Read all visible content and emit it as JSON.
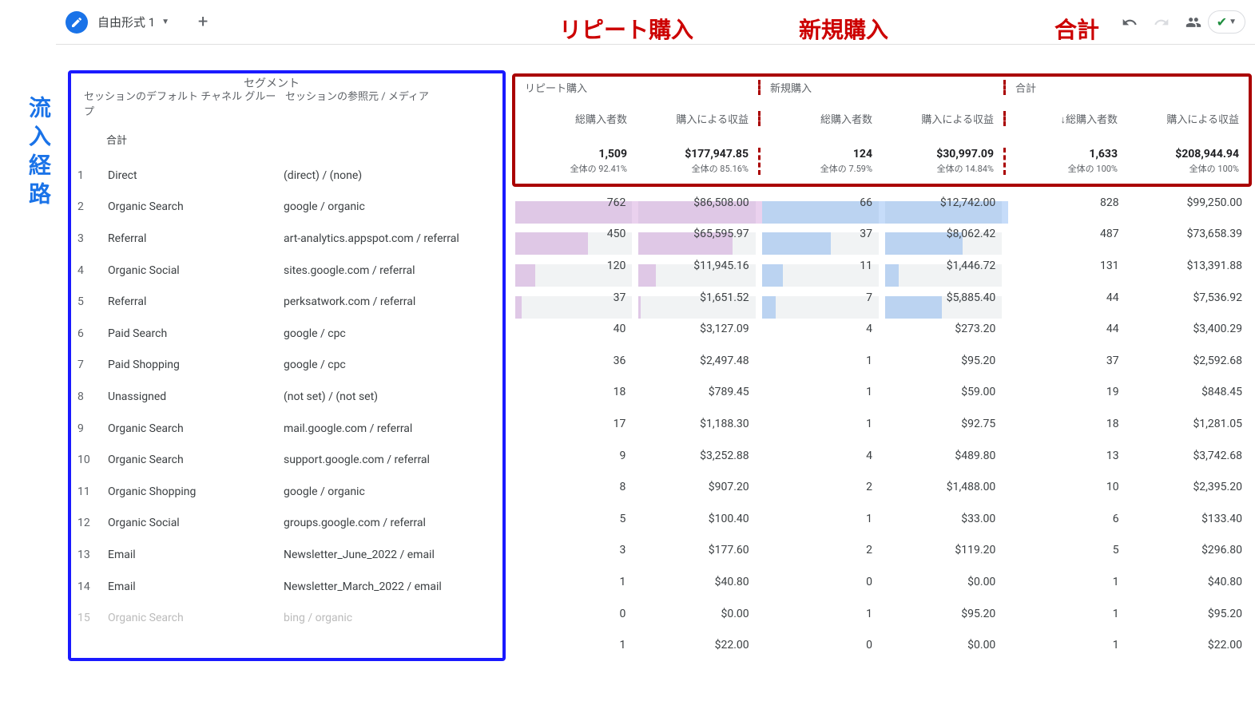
{
  "annotations": {
    "repeat": "リピート購入",
    "new": "新規購入",
    "total": "合計",
    "inflow": "流入経路"
  },
  "toolbar": {
    "tab_name": "自由形式 1",
    "segment_label": "セグメント"
  },
  "columns": {
    "channel_group": "セッションのデフォルト チャネル グループ",
    "source_medium": "セッションの参照元 / メディア",
    "seg_repeat": "リピート購入",
    "seg_new": "新規購入",
    "seg_total": "合計",
    "purchasers": "総購入者数",
    "revenue": "購入による収益",
    "sort_purchasers": "↓総購入者数",
    "total_label": "合計"
  },
  "totals": {
    "repeat_purchasers": "1,509",
    "repeat_purchasers_pct": "全体の 92.41%",
    "repeat_revenue": "$177,947.85",
    "repeat_revenue_pct": "全体の 85.16%",
    "new_purchasers": "124",
    "new_purchasers_pct": "全体の 7.59%",
    "new_revenue": "$30,997.09",
    "new_revenue_pct": "全体の 14.84%",
    "total_purchasers": "1,633",
    "total_purchasers_pct": "全体の 100%",
    "total_revenue": "$208,944.94",
    "total_revenue_pct": "全体の 100%"
  },
  "rows": [
    {
      "n": "1",
      "channel": "Direct",
      "source": "(direct) / (none)",
      "rp": "762",
      "rr": "$86,508.00",
      "np": "66",
      "nr": "$12,742.00",
      "tp": "828",
      "tr": "$99,250.00",
      "rp_bar": 100,
      "rr_bar": 100,
      "np_bar": 100,
      "nr_bar": 100
    },
    {
      "n": "2",
      "channel": "Organic Search",
      "source": "google / organic",
      "rp": "450",
      "rr": "$65,595.97",
      "np": "37",
      "nr": "$8,062.42",
      "tp": "487",
      "tr": "$73,658.39",
      "rp_bar": 59,
      "rr_bar": 76,
      "np_bar": 56,
      "nr_bar": 63
    },
    {
      "n": "3",
      "channel": "Referral",
      "source": "art-analytics.appspot.com / referral",
      "rp": "120",
      "rr": "$11,945.16",
      "np": "11",
      "nr": "$1,446.72",
      "tp": "131",
      "tr": "$13,391.88",
      "rp_bar": 16,
      "rr_bar": 14,
      "np_bar": 17,
      "nr_bar": 11
    },
    {
      "n": "4",
      "channel": "Organic Social",
      "source": "sites.google.com / referral",
      "rp": "37",
      "rr": "$1,651.52",
      "np": "7",
      "nr": "$5,885.40",
      "tp": "44",
      "tr": "$7,536.92",
      "rp_bar": 5,
      "rr_bar": 2,
      "np_bar": 11,
      "nr_bar": 46
    },
    {
      "n": "5",
      "channel": "Referral",
      "source": "perksatwork.com / referral",
      "rp": "40",
      "rr": "$3,127.09",
      "np": "4",
      "nr": "$273.20",
      "tp": "44",
      "tr": "$3,400.29",
      "rp_bar": 5,
      "rr_bar": 4,
      "np_bar": 6,
      "nr_bar": 2
    },
    {
      "n": "6",
      "channel": "Paid Search",
      "source": "google / cpc",
      "rp": "36",
      "rr": "$2,497.48",
      "np": "1",
      "nr": "$95.20",
      "tp": "37",
      "tr": "$2,592.68",
      "rp_bar": 5,
      "rr_bar": 3,
      "np_bar": 2,
      "nr_bar": 1
    },
    {
      "n": "7",
      "channel": "Paid Shopping",
      "source": "google / cpc",
      "rp": "18",
      "rr": "$789.45",
      "np": "1",
      "nr": "$59.00",
      "tp": "19",
      "tr": "$848.45",
      "rp_bar": 2,
      "rr_bar": 1,
      "np_bar": 2,
      "nr_bar": 0
    },
    {
      "n": "8",
      "channel": "Unassigned",
      "source": "(not set) / (not set)",
      "rp": "17",
      "rr": "$1,188.30",
      "np": "1",
      "nr": "$92.75",
      "tp": "18",
      "tr": "$1,281.05",
      "rp_bar": 2,
      "rr_bar": 1,
      "np_bar": 2,
      "nr_bar": 1
    },
    {
      "n": "9",
      "channel": "Organic Search",
      "source": "mail.google.com / referral",
      "rp": "9",
      "rr": "$3,252.88",
      "np": "4",
      "nr": "$489.80",
      "tp": "13",
      "tr": "$3,742.68",
      "rp_bar": 1,
      "rr_bar": 4,
      "np_bar": 6,
      "nr_bar": 4
    },
    {
      "n": "10",
      "channel": "Organic Search",
      "source": "support.google.com / referral",
      "rp": "8",
      "rr": "$907.20",
      "np": "2",
      "nr": "$1,488.00",
      "tp": "10",
      "tr": "$2,395.20",
      "rp_bar": 1,
      "rr_bar": 1,
      "np_bar": 3,
      "nr_bar": 12
    },
    {
      "n": "11",
      "channel": "Organic Shopping",
      "source": "google / organic",
      "rp": "5",
      "rr": "$100.40",
      "np": "1",
      "nr": "$33.00",
      "tp": "6",
      "tr": "$133.40",
      "rp_bar": 1,
      "rr_bar": 0,
      "np_bar": 2,
      "nr_bar": 0
    },
    {
      "n": "12",
      "channel": "Organic Social",
      "source": "groups.google.com / referral",
      "rp": "3",
      "rr": "$177.60",
      "np": "2",
      "nr": "$119.20",
      "tp": "5",
      "tr": "$296.80",
      "rp_bar": 0,
      "rr_bar": 0,
      "np_bar": 3,
      "nr_bar": 1
    },
    {
      "n": "13",
      "channel": "Email",
      "source": "Newsletter_June_2022 / email",
      "rp": "1",
      "rr": "$40.80",
      "np": "0",
      "nr": "$0.00",
      "tp": "1",
      "tr": "$40.80",
      "rp_bar": 0,
      "rr_bar": 0,
      "np_bar": 0,
      "nr_bar": 0
    },
    {
      "n": "14",
      "channel": "Email",
      "source": "Newsletter_March_2022 / email",
      "rp": "0",
      "rr": "$0.00",
      "np": "1",
      "nr": "$95.20",
      "tp": "1",
      "tr": "$95.20",
      "rp_bar": 0,
      "rr_bar": 0,
      "np_bar": 2,
      "nr_bar": 1
    },
    {
      "n": "15",
      "channel": "Organic Search",
      "source": "bing / organic",
      "rp": "1",
      "rr": "$22.00",
      "np": "0",
      "nr": "$0.00",
      "tp": "1",
      "tr": "$22.00",
      "rp_bar": 0,
      "rr_bar": 0,
      "np_bar": 0,
      "nr_bar": 0,
      "faded": true
    }
  ]
}
